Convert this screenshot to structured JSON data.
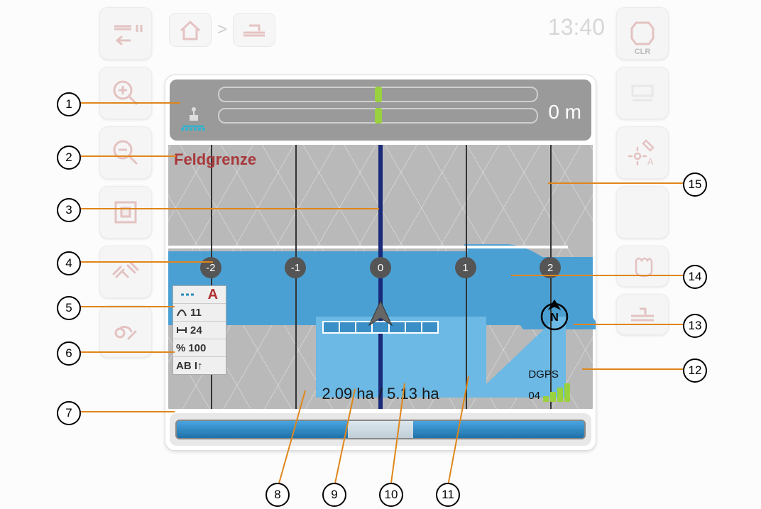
{
  "header": {
    "clock": "13:40",
    "crumb_home_icon": "home-icon",
    "crumb_sep": ">",
    "crumb_app_icon": "tractor-icon"
  },
  "side_left": [
    {
      "name": "tractor-pause-back-button"
    },
    {
      "name": "zoom-in-button"
    },
    {
      "name": "zoom-out-button"
    },
    {
      "name": "record-button"
    },
    {
      "name": "satellite-button"
    },
    {
      "name": "settings-wrench-button"
    }
  ],
  "side_right": [
    {
      "name": "clr-button",
      "label": "CLR"
    },
    {
      "name": "tractor-faded-button"
    },
    {
      "name": "set-a-point-button"
    },
    {
      "name": "blank-button-1"
    },
    {
      "name": "auto-hand-button"
    },
    {
      "name": "auto-tractor-button"
    }
  ],
  "lightbar": {
    "distance": "0 m"
  },
  "map": {
    "boundary_label": "Feldgrenze",
    "tracks": [
      "-2",
      "-1",
      "0",
      "1",
      "2"
    ],
    "area_worked": "2.09 ha",
    "area_total": "5.13 ha",
    "area_sep": " / ",
    "dgps_label": "DGPS",
    "dgps_id": "04"
  },
  "status": {
    "mode": "A",
    "row1_icon": "curve",
    "row1": "11",
    "row2_icon": "width",
    "row2": "24",
    "row3_icon": "percent",
    "row3": "100",
    "row4": "AB I↑"
  },
  "callouts": {
    "1": "1",
    "2": "2",
    "3": "3",
    "4": "4",
    "5": "5",
    "6": "6",
    "7": "7",
    "8": "8",
    "9": "9",
    "10": "10",
    "11": "11",
    "12": "12",
    "13": "13",
    "14": "14",
    "15": "15"
  }
}
